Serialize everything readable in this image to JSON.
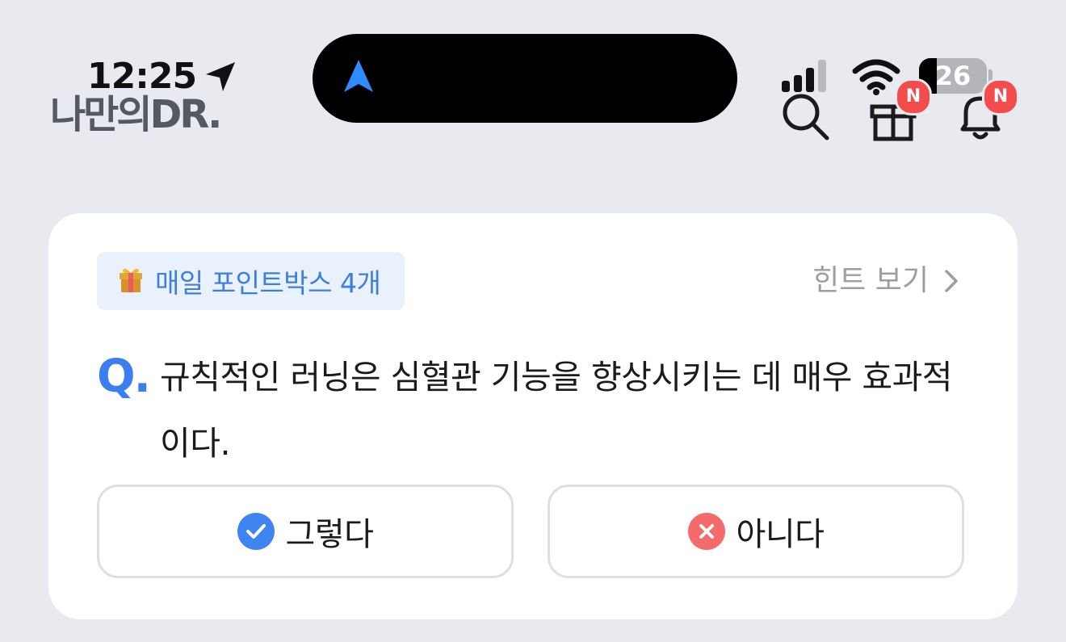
{
  "status_bar": {
    "time": "12:25",
    "location_icon": "location-arrow-icon",
    "battery_percent": "26",
    "battery_level": 0.26,
    "signal_bars_active": 3,
    "signal_bars_total": 4,
    "island_icon": "navigation-arrow-icon"
  },
  "header": {
    "logo": "나만의DR.",
    "icons": [
      "search-icon",
      "gift-icon",
      "bell-icon"
    ],
    "gift_badge": "N",
    "bell_badge": "N"
  },
  "quiz_card": {
    "points_label": "매일 포인트박스 4개",
    "points_icon": "gift-emoji-icon",
    "hint_label": "힌트 보기",
    "question_prefix": "Q.",
    "question_text": "규칙적인 러닝은 심혈관 기능을 향상시키는 데 매우 효과적이다.",
    "answers": [
      {
        "label": "그렇다",
        "icon": "check-circle-icon",
        "color": "#3f85f2"
      },
      {
        "label": "아니다",
        "icon": "x-circle-icon",
        "color": "#f36b6b"
      }
    ]
  },
  "colors": {
    "accent_blue": "#3a7ef0",
    "badge_red": "#f24c4c",
    "background": "#e9eaef",
    "card": "#ffffff"
  }
}
